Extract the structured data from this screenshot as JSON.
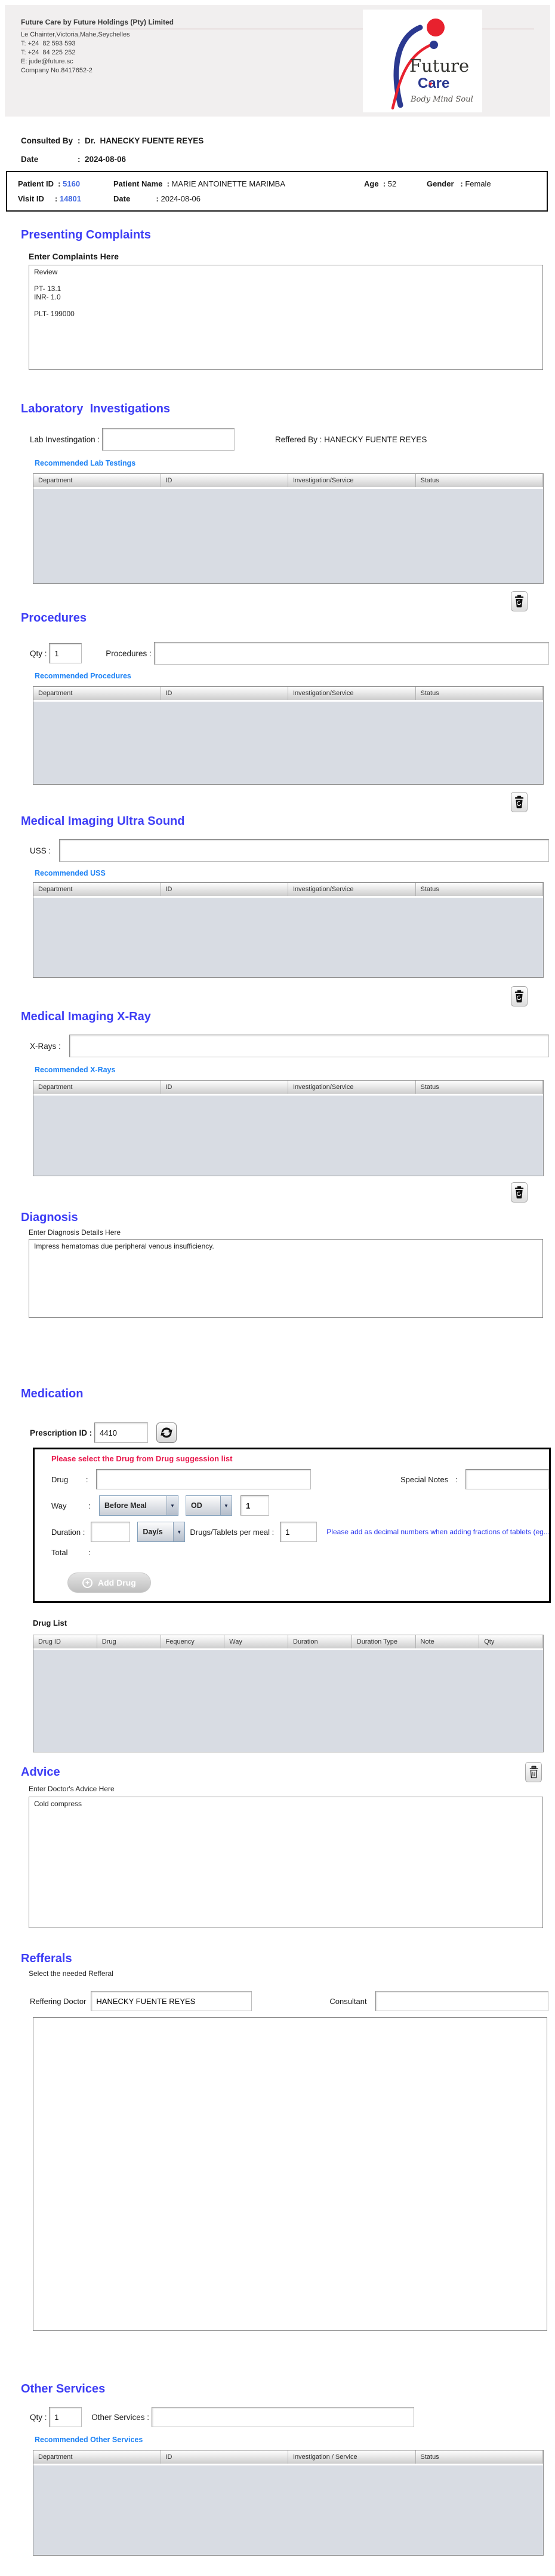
{
  "ui": {
    "colon": ":",
    "dropdown_arrow": "▼"
  },
  "colors": {
    "section_heading": "#3d3df5",
    "link_blue": "#1d82f5",
    "warning_red": "#e8174b",
    "id_blue": "#4169e1",
    "table_body_gray": "#d8dce3",
    "logo_blue": "#2b3990",
    "logo_red": "#e8212e"
  },
  "header": {
    "title": "Future Care by Future Holdings (Pty) Limited",
    "address_lines": [
      "Le Chainter,Victoria,Mahe,Seychelles",
      "T: +24  82 593 593",
      "T: +24  84 225 252",
      "E: jude@future.sc",
      "Company No.8417652-2"
    ],
    "logo": {
      "name_top": "Future",
      "name_bottom": "Care",
      "tagline": "Body Mind Soul"
    }
  },
  "consulted": {
    "label": "Consulted By",
    "value": ":  Dr.  HANECKY FUENTE REYES",
    "date_label": "Date",
    "date_value": ":  2024-08-06"
  },
  "patient_bar": {
    "patient_id_label": "Patient ID  :",
    "patient_id": "5160",
    "patient_name_label": "Patient Name  :",
    "patient_name": "MARIE ANTOINETTE MARIMBA",
    "age_label": "Age  :",
    "age": "52",
    "gender_label": "Gender   :",
    "gender": "Female",
    "visit_id_label": "Visit ID     :",
    "visit_id": "14801",
    "date_label": "Date            :",
    "date": "2024-08-06"
  },
  "presenting_complaints": {
    "title": "Presenting Complaints",
    "label": "Enter Complaints Here",
    "value": "Review\n\nPT- 13.1\nINR- 1.0\n\nPLT- 199000"
  },
  "laboratory": {
    "title": "Laboratory  Investigations",
    "input_label": "Lab Investingation : ",
    "input_value": "",
    "reffered_by_label": "Reffered By : ",
    "reffered_by": "HANECKY FUENTE REYES",
    "link": "Recommended Lab Testings",
    "columns": [
      "Department",
      "ID",
      "Investigation/Service",
      "Status"
    ]
  },
  "procedures": {
    "title": "Procedures",
    "qty_label": "Qty : ",
    "qty_value": "1",
    "input_label": "Procedures : ",
    "input_value": "",
    "link": "Recommended Procedures",
    "columns": [
      "Department",
      "ID",
      "Investigation/Service",
      "Status"
    ]
  },
  "ultrasound": {
    "title": "Medical Imaging Ultra Sound",
    "input_label": "USS : ",
    "input_value": "",
    "link": "Recommended USS",
    "columns": [
      "Department",
      "ID",
      "Investigation/Service",
      "Status"
    ]
  },
  "xray": {
    "title": "Medical Imaging X-Ray",
    "input_label": "X-Rays : ",
    "input_value": "",
    "link": "Recommended X-Rays",
    "columns": [
      "Department",
      "ID",
      "Investigation/Service",
      "Status"
    ]
  },
  "diagnosis": {
    "title": "Diagnosis",
    "label": "Enter Diagnosis Details Here",
    "value": "Impress hematomas due peripheral venous insufficiency."
  },
  "medication": {
    "title": "Medication",
    "prescription_id_label": "Prescription ID : ",
    "prescription_id": "4410",
    "warning": "Please select the Drug from Drug suggession list",
    "drug_label": "Drug",
    "drug_value": "",
    "special_notes_label": "Special Notes",
    "special_notes_value": "",
    "way_label": "Way",
    "way_selected": "Before Meal",
    "frequency_selected": "OD",
    "frequency_qty": "1",
    "duration_label": "Duration :",
    "duration_value": "",
    "duration_type_selected": "Day/s",
    "per_meal_label": "Drugs/Tablets per meal :",
    "per_meal_value": "1",
    "fraction_note": "Please add as decimal numbers when adding fractions of tablets (eg...",
    "total_label": "Total",
    "add_drug_label": "Add Drug",
    "drug_list_label": "Drug List",
    "columns": [
      "Drug ID",
      "Drug",
      "Fequency",
      "Way",
      "Duration",
      "Duration Type",
      "Note",
      "Qty"
    ]
  },
  "advice": {
    "title": "Advice",
    "label": "Enter Doctor's Advice Here",
    "value": "Cold compress"
  },
  "refferals": {
    "title": "Refferals",
    "subtitle": "Select the needed Refferal",
    "reffering_doctor_label": "Reffering Doctor",
    "reffering_doctor_value": "HANECKY FUENTE REYES",
    "consultant_label": "Consultant",
    "consultant_value": ""
  },
  "other_services": {
    "title": "Other Services",
    "qty_label": "Qty : ",
    "qty_value": "1",
    "input_label": "Other Services : ",
    "input_value": "",
    "link": "Recommended Other Services",
    "columns": [
      "Department",
      "ID",
      "Investigation / Service",
      "Status"
    ]
  }
}
